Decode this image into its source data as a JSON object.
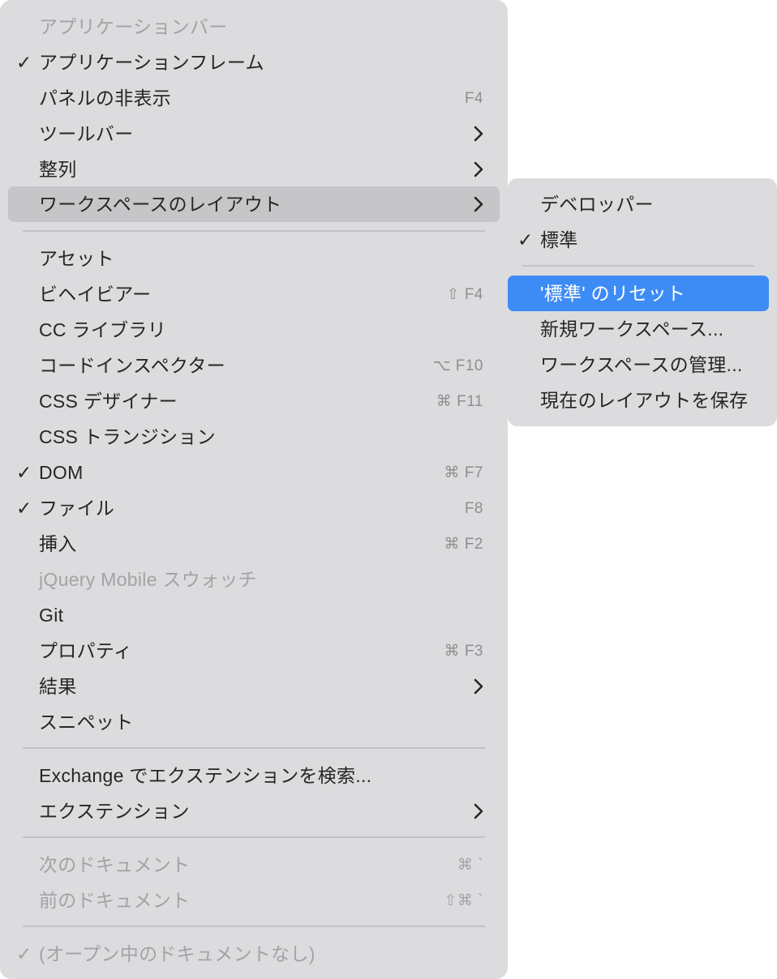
{
  "main_menu": {
    "items": [
      {
        "label": "アプリケーションバー",
        "disabled": true
      },
      {
        "label": "アプリケーションフレーム",
        "checked": true
      },
      {
        "label": "パネルの非表示",
        "shortcut": "F4"
      },
      {
        "label": "ツールバー",
        "submenu": true
      },
      {
        "label": "整列",
        "submenu": true
      },
      {
        "label": "ワークスペースのレイアウト",
        "submenu": true,
        "highlighted": true
      },
      {
        "label": "アセット"
      },
      {
        "label": "ビヘイビアー",
        "shortcut": "⇧ F4"
      },
      {
        "label": "CC ライブラリ"
      },
      {
        "label": "コードインスペクター",
        "shortcut": "⌥ F10"
      },
      {
        "label": "CSS デザイナー",
        "shortcut": "⌘ F11"
      },
      {
        "label": "CSS トランジション"
      },
      {
        "label": "DOM",
        "checked": true,
        "shortcut": "⌘ F7"
      },
      {
        "label": "ファイル",
        "checked": true,
        "shortcut": "F8"
      },
      {
        "label": "挿入",
        "shortcut": "⌘ F2"
      },
      {
        "label": "jQuery Mobile スウォッチ",
        "disabled": true
      },
      {
        "label": "Git"
      },
      {
        "label": "プロパティ",
        "shortcut": "⌘ F3"
      },
      {
        "label": "結果",
        "submenu": true
      },
      {
        "label": "スニペット"
      },
      {
        "label": "Exchange でエクステンションを検索..."
      },
      {
        "label": "エクステンション",
        "submenu": true
      },
      {
        "label": "次のドキュメント",
        "disabled": true,
        "shortcut": "⌘ `"
      },
      {
        "label": "前のドキュメント",
        "disabled": true,
        "shortcut": "⇧⌘ `"
      },
      {
        "label": "(オープン中のドキュメントなし)",
        "disabled": true,
        "checked": true
      }
    ]
  },
  "submenu": {
    "items": [
      {
        "label": "デベロッパー"
      },
      {
        "label": "標準",
        "checked": true
      },
      {
        "label": "'標準' のリセット",
        "selected": true
      },
      {
        "label": "新規ワークスペース..."
      },
      {
        "label": "ワークスペースの管理..."
      },
      {
        "label": "現在のレイアウトを保存"
      }
    ]
  },
  "icons": {
    "check": "checkmark-icon",
    "submenu": "chevron-right-icon"
  },
  "colors": {
    "selection": "#3d8cf5",
    "menu_bg": "#dcdcde",
    "highlight": "#c6c6c9"
  }
}
